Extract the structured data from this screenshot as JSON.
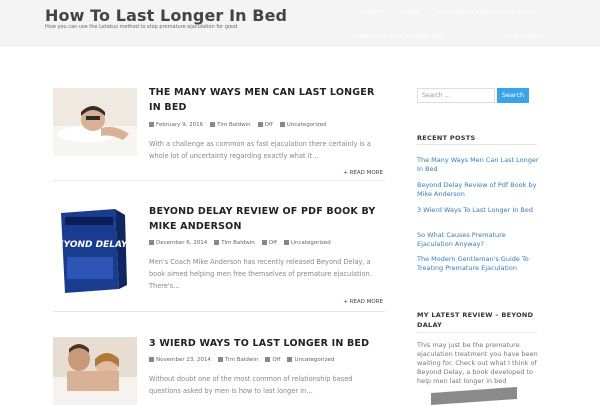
{
  "site": {
    "title": "How To Last Longer In Bed",
    "description": "How you can use the Letskus method to stop premature ejaculation for good"
  },
  "nav": {
    "items": [
      "About",
      "Ebook",
      "Premature Ejaculation Help",
      "Premature Ejaculation FAQ",
      "Disclaimer"
    ]
  },
  "posts": [
    {
      "title": "The Many Ways Men Can Last Longer In Bed",
      "date": "February 9, 2016",
      "author": "Tim Baldwin",
      "comments": "Off",
      "category": "Uncategorized",
      "excerpt": "With a challenge as common as fast ejaculation there certainly is a whole lot of uncertainty regarding exactly what it…",
      "more": "+ Read More"
    },
    {
      "title": "Beyond Delay Review of Pdf Book by Mike Anderson",
      "date": "December 6, 2014",
      "author": "Tim Baldwin",
      "comments": "Off",
      "category": "Uncategorized",
      "excerpt": "Men's Coach Mike Anderson has recently released Beyond Delay, a book aimed helping men free themselves of premature ejaculation. There's…",
      "more": "+ Read More"
    },
    {
      "title": "3 Wierd Ways To Last Longer In Bed",
      "date": "November 23, 2014",
      "author": "Tim Baldwin",
      "comments": "Off",
      "category": "Uncategorized",
      "excerpt": "Without doubt one of the most common of relationship based questions asked by men is how to last longer in…"
    }
  ],
  "sidebar": {
    "search_placeholder": "Search …",
    "search_button": "Search",
    "recent_title": "Recent Posts",
    "recent": [
      "The Many Ways Men Can Last Longer In Bed",
      "Beyond Delay Review of Pdf Book by Mike Anderson",
      "3 Wierd Ways To Last Longer In Bed",
      "So What Causes Premature Ejaculation Anyway?",
      "The Modern Gentleman's Guide To Treating Premature Ejaculation"
    ],
    "review_title": "My Latest Review – Beyond Dalay",
    "review_text": "This may just be the premature ejaculation treatment you have been waiting for. Check out what I think of Beyond Delay, a book developed to help men last longer in bed",
    "book_cover_text": "BEYOND DELAY"
  },
  "colors": {
    "accent": "#3ba3e6",
    "link": "#3a7ab8"
  }
}
